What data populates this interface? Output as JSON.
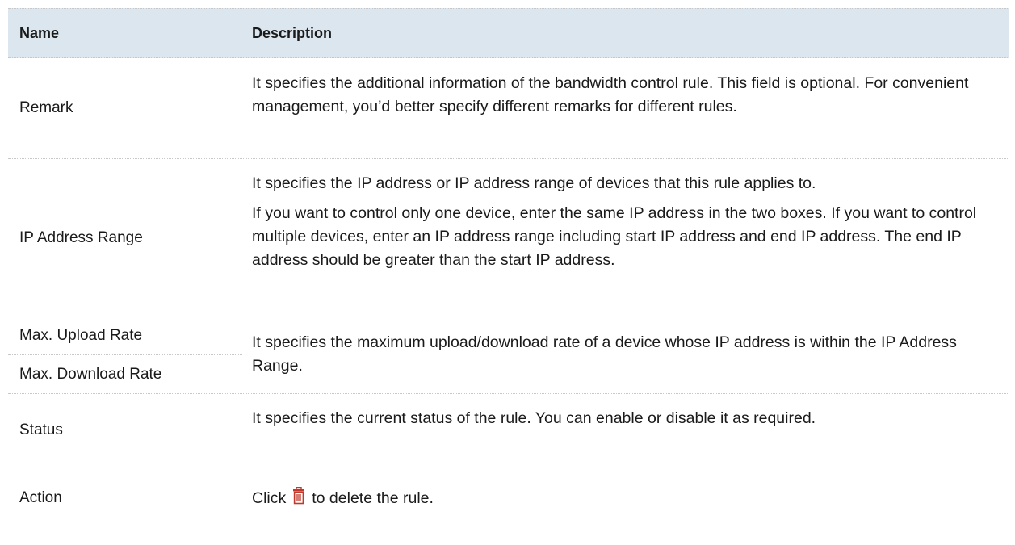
{
  "header": {
    "name": "Name",
    "description": "Description"
  },
  "rows": [
    {
      "name": "Remark",
      "description": "It specifies the additional information of the bandwidth control rule. This field is optional. For convenient management, you’d better specify different remarks for different rules."
    },
    {
      "name": "IP Address Range",
      "description_p1": "It specifies the IP address or IP address range of devices that this rule applies to.",
      "description_p2": "If you want to control only one device, enter the same IP address in the two boxes. If you want to control multiple devices, enter an IP address range including start IP address and end IP address. The end IP address should be greater than the start IP address."
    },
    {
      "name_upload": "Max. Upload Rate",
      "name_download": "Max. Download Rate",
      "description": "It specifies the maximum upload/download rate of a device whose IP address is within the IP Address Range."
    },
    {
      "name": "Status",
      "description": "It specifies the current status of the rule. You can enable or disable it as required."
    },
    {
      "name": "Action",
      "description_before": "Click",
      "description_after": "to delete the rule.",
      "icon": "trash-icon",
      "icon_color": "#c0392b"
    }
  ]
}
